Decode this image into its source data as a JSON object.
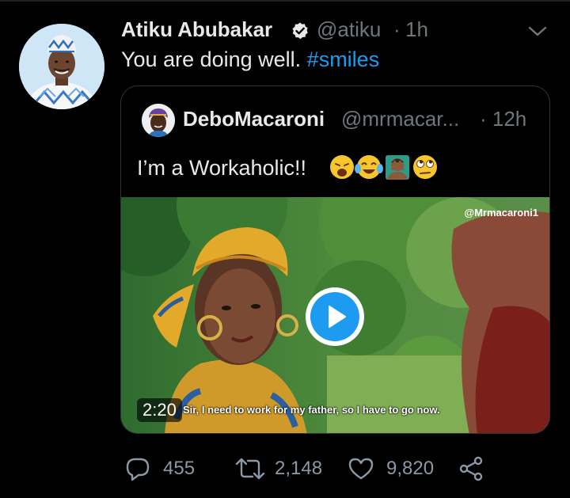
{
  "tweet": {
    "author_name": "Atiku Abubakar",
    "author_handle": "@atiku",
    "separator": "·",
    "time": "1h",
    "text_before": "You are doing well. ",
    "hashtag": "#smiles"
  },
  "quoted": {
    "author_name": "DeboMacaroni",
    "author_handle": "@mrmacar...",
    "time": "· 12h",
    "text": "I’m a Workaholic!!",
    "emoji_icons": [
      "weary-face-icon",
      "tears-of-joy-icon",
      "facepalm-icon",
      "rolling-eyes-icon"
    ],
    "video": {
      "watermark": "@Mrmacaroni1",
      "duration": "2:20",
      "subtitle": "Sir, I need to work for my father, so I have to go now."
    }
  },
  "actions": {
    "replies": "455",
    "retweets": "2,148",
    "likes": "9,820"
  },
  "colors": {
    "background": "#000000",
    "link": "#1d9bf0",
    "secondary_text": "#71767b"
  }
}
